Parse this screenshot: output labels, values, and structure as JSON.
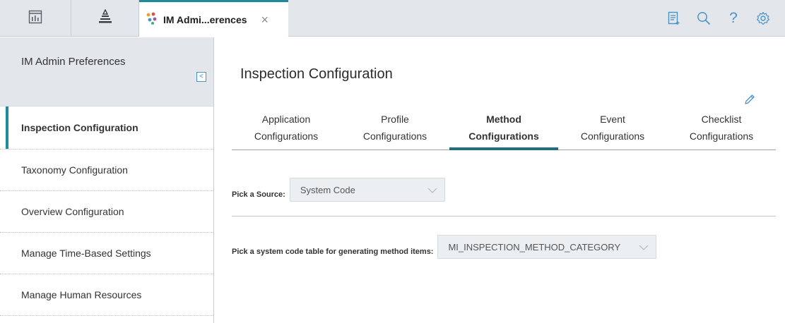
{
  "topbar": {
    "icons": [
      "dashboard-icon",
      "hierarchy-icon"
    ],
    "active_tab": {
      "label": "IM Admi...erences",
      "icon": "team-icon",
      "close": "×"
    },
    "actions": [
      "clipboard-add-icon",
      "search-icon",
      "help-icon",
      "settings-icon"
    ],
    "help_glyph": "?"
  },
  "sidebar": {
    "title": "IM Admin Preferences",
    "collapse_glyph": "<",
    "items": [
      {
        "label": "Inspection Configuration"
      },
      {
        "label": "Taxonomy Configuration"
      },
      {
        "label": "Overview Configuration"
      },
      {
        "label": "Manage Time-Based Settings"
      },
      {
        "label": "Manage Human Resources"
      }
    ]
  },
  "main": {
    "title": "Inspection Configuration",
    "tabs": [
      {
        "line1": "Application",
        "line2": "Configurations"
      },
      {
        "line1": "Profile",
        "line2": "Configurations"
      },
      {
        "line1": "Method",
        "line2": "Configurations"
      },
      {
        "line1": "Event",
        "line2": "Configurations"
      },
      {
        "line1": "Checklist",
        "line2": "Configurations"
      }
    ],
    "source": {
      "label": "Pick a Source:",
      "value": "System Code"
    },
    "code_table": {
      "label": "Pick a system code table for generating method items:",
      "value": "MI_INSPECTION_METHOD_CATEGORY"
    }
  },
  "colors": {
    "accent": "#1f8a9b",
    "icon": "#4a93c7"
  }
}
